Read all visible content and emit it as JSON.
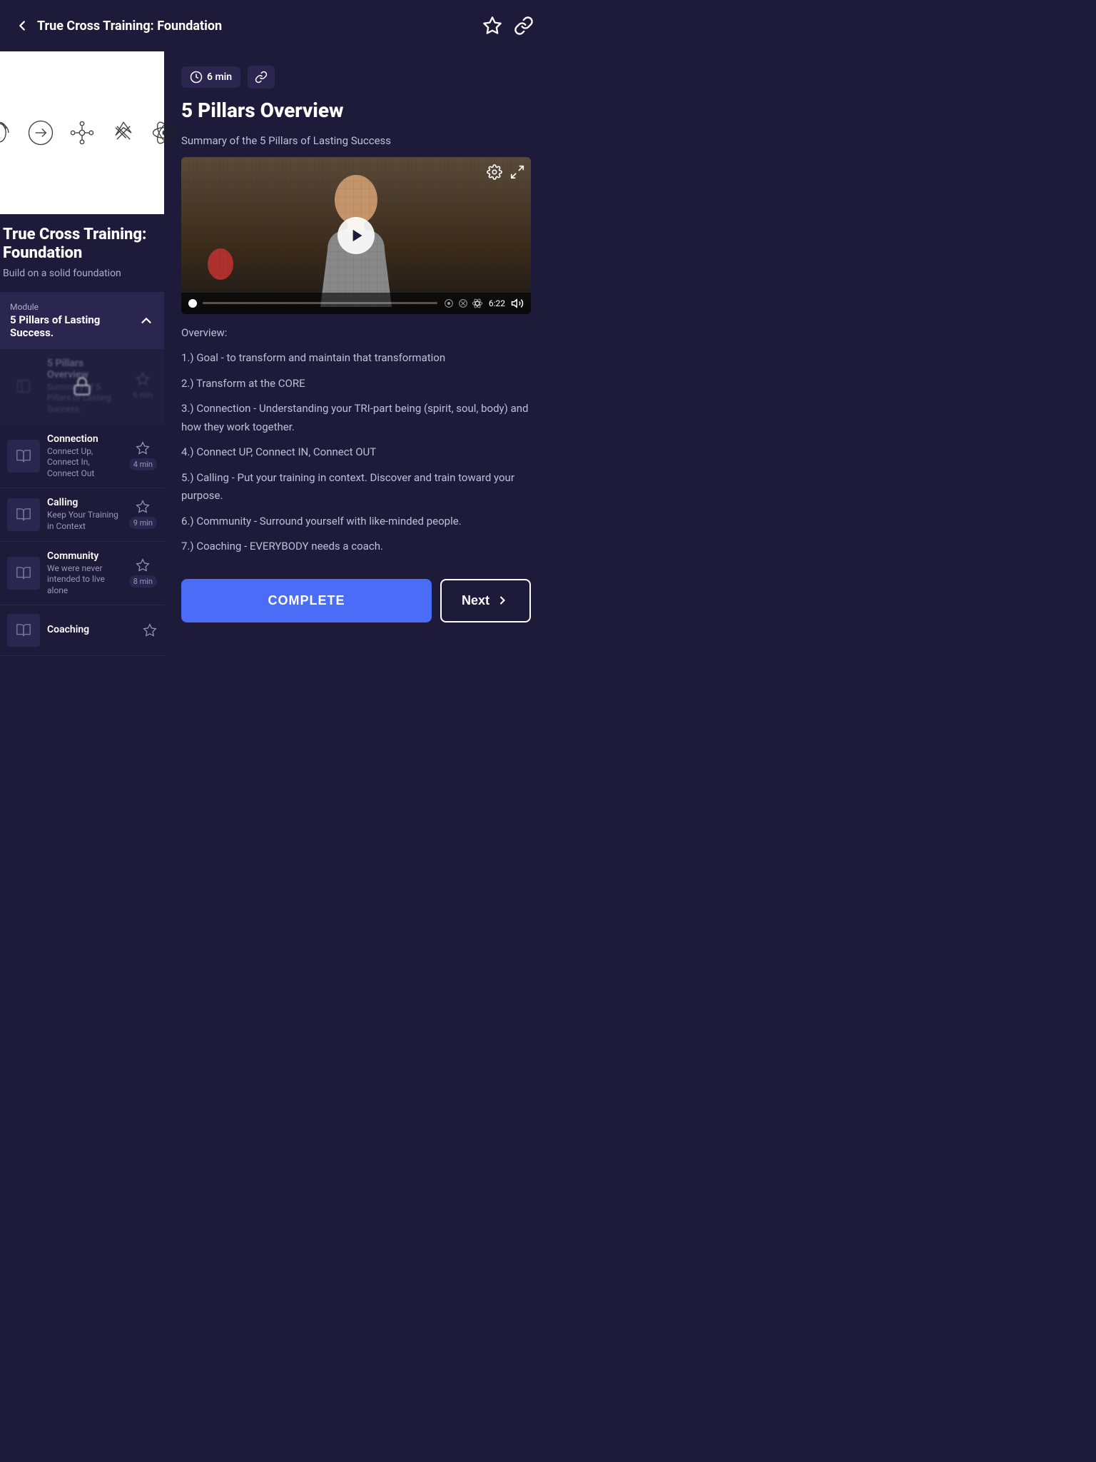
{
  "header": {
    "back_label": "True Cross Training: Foundation",
    "title": "True Cross Training: Foundation"
  },
  "course": {
    "title": "True Cross Training: Foundation",
    "subtitle": "Build on a solid foundation",
    "module_label": "Module",
    "module_name": "5 Pillars of Lasting Success."
  },
  "lessons": [
    {
      "name": "5 Pillars Overview",
      "desc": "Summary of 5 Pillars of Lasting Success.",
      "duration": "6 min",
      "locked": true
    },
    {
      "name": "Connection",
      "desc": "Connect Up, Connect In, Connect Out",
      "duration": "4 min",
      "locked": false
    },
    {
      "name": "Calling",
      "desc": "Keep Your Training in Context",
      "duration": "9 min",
      "locked": false
    },
    {
      "name": "Community",
      "desc": "We were never intended to live alone",
      "duration": "8 min",
      "locked": false
    },
    {
      "name": "Coaching",
      "desc": "",
      "duration": "",
      "locked": false
    }
  ],
  "content": {
    "duration": "6 min",
    "title": "5 Pillars Overview",
    "summary": "Summary of the 5 Pillars of Lasting Success",
    "video_time": "6:22",
    "overview_label": "Overview:",
    "overview_points": [
      "1.) Goal - to transform and maintain that transformation",
      "2.) Transform at the CORE",
      "3.) Connection - Understanding your TRI-part being (spirit, soul, body) and how they work together.",
      "4.) Connect UP, Connect IN, Connect OUT",
      "5.) Calling - Put your training in context. Discover and train toward your purpose.",
      "6.) Community - Surround yourself with like-minded people.",
      "7.) Coaching - EVERYBODY needs a coach."
    ]
  },
  "actions": {
    "complete_label": "COMPLETE",
    "next_label": "Next"
  }
}
